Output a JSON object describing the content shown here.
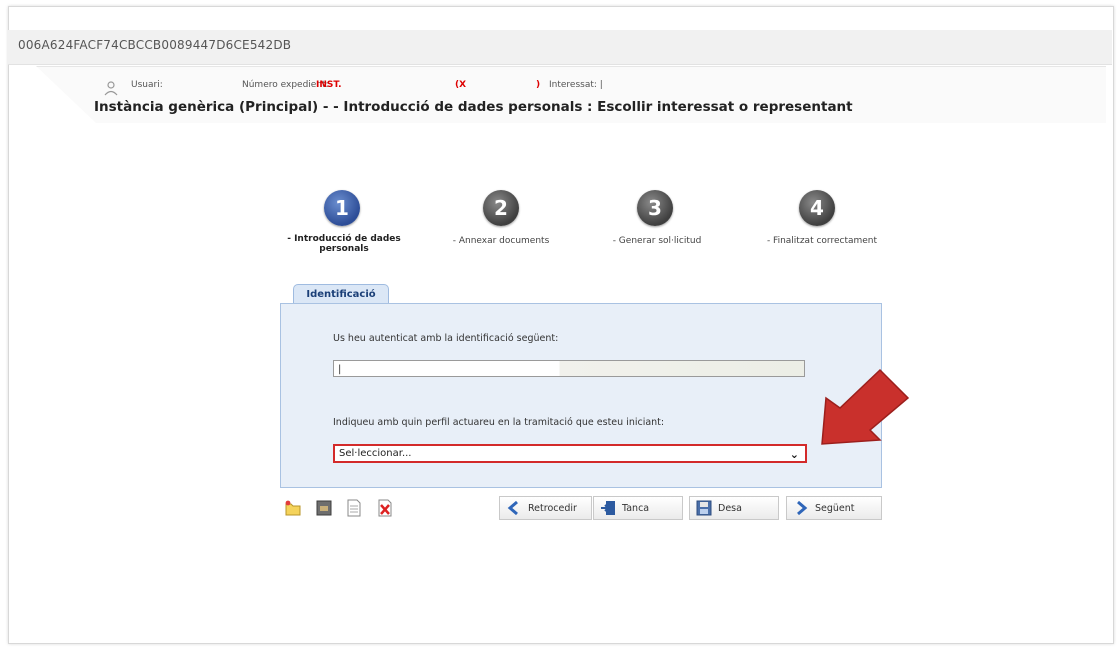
{
  "session_id": "006A624FACF74CBCCB0089447D6CE542DB",
  "header": {
    "user_label": "Usuari:",
    "expedient_label": "Número expedient:",
    "expedient_value": "INST.",
    "expedient_paren_open": "(X",
    "expedient_paren_close": ")",
    "interessat_label": "Interessat: |",
    "title": "Instància genèrica (Principal) - - Introducció de dades personals : Escollir interessat o representant"
  },
  "steps": [
    {
      "number": "1",
      "label_line1": "- Introducció de dades",
      "label_line2": "personals",
      "active": true
    },
    {
      "number": "2",
      "label_line1": "- Annexar documents",
      "label_line2": "",
      "active": false
    },
    {
      "number": "3",
      "label_line1": "- Generar sol·licitud",
      "label_line2": "",
      "active": false
    },
    {
      "number": "4",
      "label_line1": "- Finalitzat correctament",
      "label_line2": "",
      "active": false
    }
  ],
  "form": {
    "tab_label": "Identificació",
    "auth_label": "Us heu autenticat amb la identificació següent:",
    "id_value": "|",
    "profile_label": "Indiqueu amb quin perfil actuareu en la tramitació que esteu iniciant:",
    "profile_select_value": "Sel·leccionar..."
  },
  "toolbar": {
    "back_label": "Retrocedir",
    "close_label": "Tanca",
    "save_label": "Desa",
    "next_label": "Següent"
  },
  "colors": {
    "active_step": "#2d4d97",
    "inactive_step": "#3f3f3f",
    "highlight_red": "#d32a2a",
    "panel_bg": "#e8eff8"
  }
}
